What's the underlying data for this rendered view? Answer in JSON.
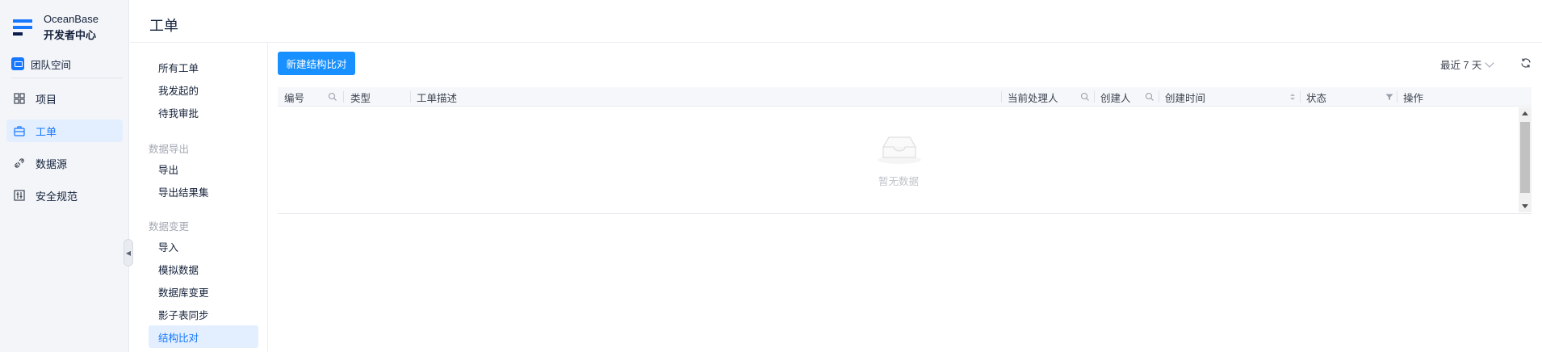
{
  "brand": {
    "name": "OceanBase",
    "subtitle": "开发者中心"
  },
  "team": {
    "label": "团队空间"
  },
  "nav": {
    "items": [
      {
        "label": "项目",
        "icon": "grid-icon",
        "active": false
      },
      {
        "label": "工单",
        "icon": "briefcase-icon",
        "active": true
      },
      {
        "label": "数据源",
        "icon": "plug-icon",
        "active": false
      },
      {
        "label": "安全规范",
        "icon": "rules-icon",
        "active": false
      }
    ]
  },
  "page": {
    "title": "工单"
  },
  "submenu": {
    "items": [
      {
        "label": "所有工单"
      },
      {
        "label": "我发起的"
      },
      {
        "label": "待我审批"
      }
    ],
    "groups": [
      {
        "title": "数据导出",
        "items": [
          {
            "label": "导出"
          },
          {
            "label": "导出结果集"
          }
        ]
      },
      {
        "title": "数据变更",
        "items": [
          {
            "label": "导入"
          },
          {
            "label": "模拟数据"
          },
          {
            "label": "数据库变更"
          },
          {
            "label": "影子表同步"
          },
          {
            "label": "结构比对",
            "active": true
          }
        ]
      }
    ]
  },
  "toolbar": {
    "create_label": "新建结构比对",
    "range_label": "最近 7 天"
  },
  "table": {
    "columns": [
      {
        "label": "编号",
        "icon": "search-icon"
      },
      {
        "label": "类型"
      },
      {
        "label": "工单描述"
      },
      {
        "label": "当前处理人",
        "icon": "search-icon"
      },
      {
        "label": "创建人",
        "icon": "search-icon"
      },
      {
        "label": "创建时间",
        "icon": "sort-icon"
      },
      {
        "label": "状态",
        "icon": "filter-icon"
      },
      {
        "label": "操作"
      }
    ],
    "empty_text": "暂无数据"
  },
  "colors": {
    "accent": "#1677ff",
    "button": "#1890ff",
    "nav_bg": "#f3f5f9",
    "active_bg": "#e3efff"
  }
}
